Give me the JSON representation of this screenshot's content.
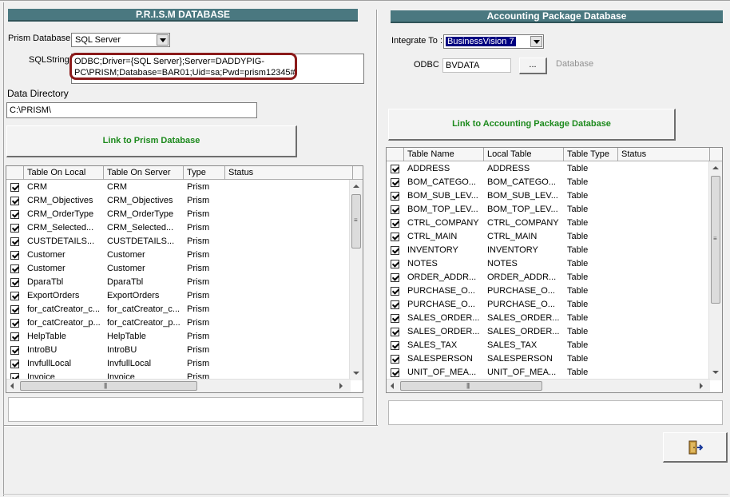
{
  "prism": {
    "header": "P.R.I.S.M DATABASE",
    "db_label": "Prism Database",
    "db_value": "SQL Server",
    "sql_label": "SQLString",
    "sql_value_line1": "ODBC;Driver={SQL Server};Server=DADDYPIG-",
    "sql_value_line2": "PC\\PRISM;Database=BAR01;Uid=sa;Pwd=prism12345#",
    "dir_label": "Data Directory",
    "dir_value": "C:\\PRISM\\",
    "link_button": "Link to Prism Database",
    "columns": [
      "Table On Local",
      "Table On Server",
      "Type",
      "Status"
    ],
    "rows": [
      {
        "local": "CRM",
        "server": "CRM",
        "type": "Prism"
      },
      {
        "local": "CRM_Objectives",
        "server": "CRM_Objectives",
        "type": "Prism"
      },
      {
        "local": "CRM_OrderType",
        "server": "CRM_OrderType",
        "type": "Prism"
      },
      {
        "local": "CRM_Selected...",
        "server": "CRM_Selected...",
        "type": "Prism"
      },
      {
        "local": "CUSTDETAILS...",
        "server": "CUSTDETAILS...",
        "type": "Prism"
      },
      {
        "local": "Customer",
        "server": "Customer",
        "type": "Prism"
      },
      {
        "local": "Customer",
        "server": "Customer",
        "type": "Prism"
      },
      {
        "local": "DparaTbl",
        "server": "DparaTbl",
        "type": "Prism"
      },
      {
        "local": "ExportOrders",
        "server": "ExportOrders",
        "type": "Prism"
      },
      {
        "local": "for_catCreator_c...",
        "server": "for_catCreator_c...",
        "type": "Prism"
      },
      {
        "local": "for_catCreator_p...",
        "server": "for_catCreator_p...",
        "type": "Prism"
      },
      {
        "local": "HelpTable",
        "server": "HelpTable",
        "type": "Prism"
      },
      {
        "local": "IntroBU",
        "server": "IntroBU",
        "type": "Prism"
      },
      {
        "local": "InvfullLocal",
        "server": "InvfullLocal",
        "type": "Prism"
      },
      {
        "local": "Invoice",
        "server": "Invoice",
        "type": "Prism"
      }
    ]
  },
  "accounting": {
    "header": "Accounting Package Database",
    "integrate_label": "Integrate To :",
    "integrate_value": "BusinessVision 7",
    "odbc_label": "ODBC",
    "odbc_value": "BVDATA",
    "browse_label": "...",
    "database_label": "Database",
    "link_button": "Link to Accounting Package Database",
    "columns": [
      "Table Name",
      "Local Table",
      "Table Type",
      "Status"
    ],
    "rows": [
      {
        "name": "ADDRESS",
        "local": "ADDRESS",
        "type": "Table"
      },
      {
        "name": "BOM_CATEGO...",
        "local": "BOM_CATEGO...",
        "type": "Table"
      },
      {
        "name": "BOM_SUB_LEV...",
        "local": "BOM_SUB_LEV...",
        "type": "Table"
      },
      {
        "name": "BOM_TOP_LEV...",
        "local": "BOM_TOP_LEV...",
        "type": "Table"
      },
      {
        "name": "CTRL_COMPANY",
        "local": "CTRL_COMPANY",
        "type": "Table"
      },
      {
        "name": "CTRL_MAIN",
        "local": "CTRL_MAIN",
        "type": "Table"
      },
      {
        "name": "INVENTORY",
        "local": "INVENTORY",
        "type": "Table"
      },
      {
        "name": "NOTES",
        "local": "NOTES",
        "type": "Table"
      },
      {
        "name": "ORDER_ADDR...",
        "local": "ORDER_ADDR...",
        "type": "Table"
      },
      {
        "name": "PURCHASE_O...",
        "local": "PURCHASE_O...",
        "type": "Table"
      },
      {
        "name": "PURCHASE_O...",
        "local": "PURCHASE_O...",
        "type": "Table"
      },
      {
        "name": "SALES_ORDER...",
        "local": "SALES_ORDER...",
        "type": "Table"
      },
      {
        "name": "SALES_ORDER...",
        "local": "SALES_ORDER...",
        "type": "Table"
      },
      {
        "name": "SALES_TAX",
        "local": "SALES_TAX",
        "type": "Table"
      },
      {
        "name": "SALESPERSON",
        "local": "SALESPERSON",
        "type": "Table"
      },
      {
        "name": "UNIT_OF_MEA...",
        "local": "UNIT_OF_MEA...",
        "type": "Table"
      }
    ]
  },
  "exit_button_icon": "exit-door-icon",
  "colors": {
    "header_bg": "#4a7880",
    "link_text": "#1d8a1d",
    "highlight": "#8b1a1a"
  }
}
